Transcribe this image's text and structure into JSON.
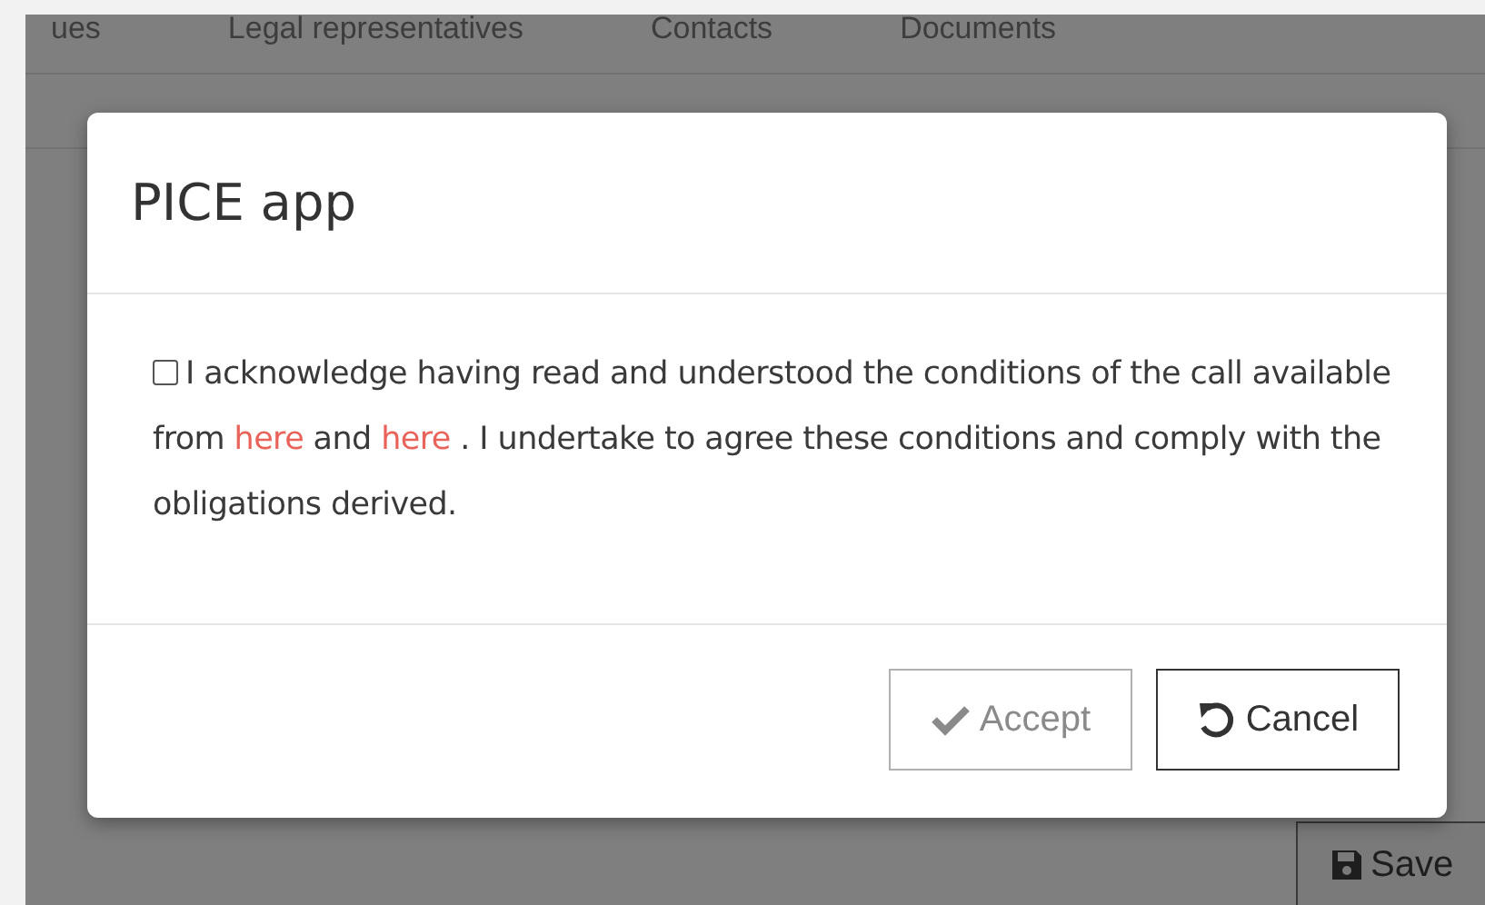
{
  "background": {
    "tabs": [
      {
        "label": "ues"
      },
      {
        "label": "Legal representatives"
      },
      {
        "label": "Contacts"
      },
      {
        "label": "Documents"
      }
    ],
    "save_button": {
      "label": "Save"
    }
  },
  "dialog": {
    "title": "PICE app",
    "consent": {
      "checked": false,
      "parts": [
        {
          "kind": "text",
          "text": "I acknowledge having read and understood the conditions of the call available from "
        },
        {
          "kind": "link",
          "text": "here"
        },
        {
          "kind": "text",
          "text": " and "
        },
        {
          "kind": "link",
          "text": "here"
        },
        {
          "kind": "text",
          "text": " . I undertake to agree these conditions and comply with the obligations derived."
        }
      ]
    },
    "buttons": [
      {
        "kind": "accept",
        "label": "Accept",
        "disabled": true
      },
      {
        "kind": "cancel",
        "label": "Cancel",
        "disabled": false
      }
    ]
  }
}
